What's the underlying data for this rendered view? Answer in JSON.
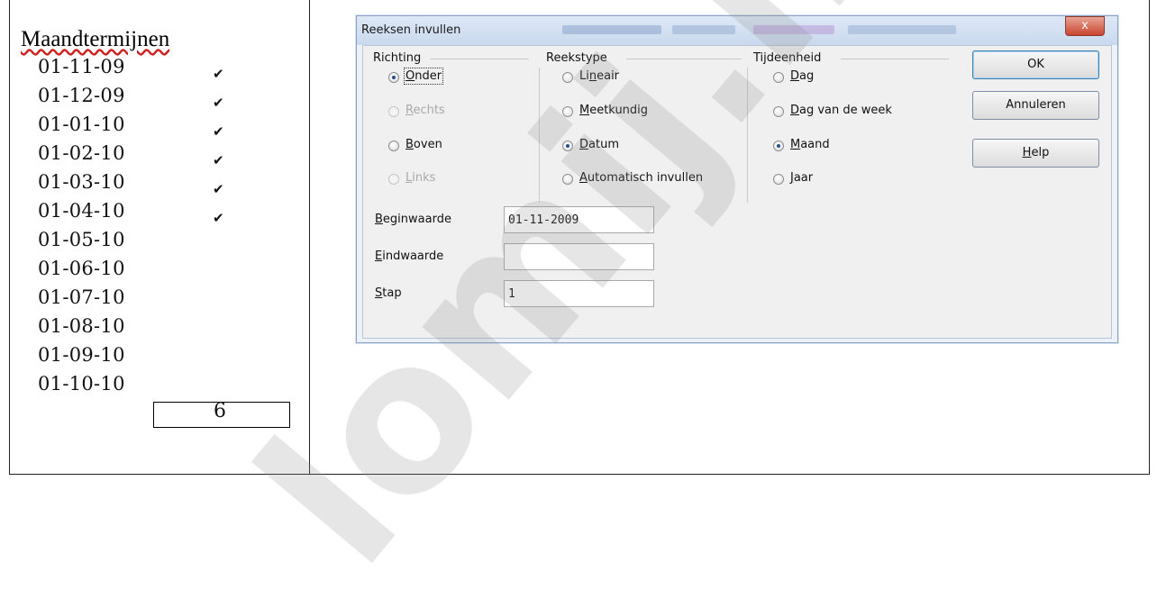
{
  "left": {
    "title": "Maandtermijnen",
    "dates": [
      "01-11-09",
      "01-12-09",
      "01-01-10",
      "01-02-10",
      "01-03-10",
      "01-04-10",
      "01-05-10",
      "01-06-10",
      "01-07-10",
      "01-08-10",
      "01-09-10",
      "01-10-10"
    ],
    "checks": [
      "✔",
      "✔",
      "✔",
      "✔",
      "✔",
      "✔"
    ],
    "count": "6"
  },
  "dialog": {
    "title": "Reeksen invullen",
    "close_glyph": "x",
    "richting": {
      "label": "Richting",
      "options": [
        {
          "pre": "",
          "u": "O",
          "post": "nder",
          "selected": true,
          "disabled": false
        },
        {
          "pre": "",
          "u": "R",
          "post": "echts",
          "selected": false,
          "disabled": true
        },
        {
          "pre": "",
          "u": "B",
          "post": "oven",
          "selected": false,
          "disabled": false
        },
        {
          "pre": "",
          "u": "L",
          "post": "inks",
          "selected": false,
          "disabled": true
        }
      ]
    },
    "reekstype": {
      "label": "Reekstype",
      "options": [
        {
          "pre": "Li",
          "u": "n",
          "post": "eair",
          "selected": false,
          "disabled": false
        },
        {
          "pre": "",
          "u": "M",
          "post": "eetkundig",
          "selected": false,
          "disabled": false
        },
        {
          "pre": "",
          "u": "D",
          "post": "atum",
          "selected": true,
          "disabled": false
        },
        {
          "pre": "",
          "u": "A",
          "post": "utomatisch invullen",
          "selected": false,
          "disabled": false
        }
      ]
    },
    "tijdeenheid": {
      "label": "Tijdeenheid",
      "options": [
        {
          "pre": "",
          "u": "D",
          "post": "ag",
          "selected": false,
          "disabled": false
        },
        {
          "pre": "",
          "u": "D",
          "post": "ag van de week",
          "selected": false,
          "disabled": false
        },
        {
          "pre": "",
          "u": "M",
          "post": "aand",
          "selected": true,
          "disabled": false
        },
        {
          "pre": "",
          "u": "J",
          "post": "aar",
          "selected": false,
          "disabled": false
        }
      ]
    },
    "fields": {
      "begin": {
        "label_u": "B",
        "label_rest": "eginwaarde",
        "value": "01-11-2009"
      },
      "eind": {
        "label_u": "E",
        "label_rest": "indwaarde",
        "value": ""
      },
      "stap": {
        "label_u": "S",
        "label_rest": "tap",
        "value": "1"
      }
    },
    "buttons": {
      "ok": "OK",
      "cancel": "Annuleren",
      "help_u": "H",
      "help_rest": "elp"
    }
  },
  "watermark": "lomij.nl"
}
